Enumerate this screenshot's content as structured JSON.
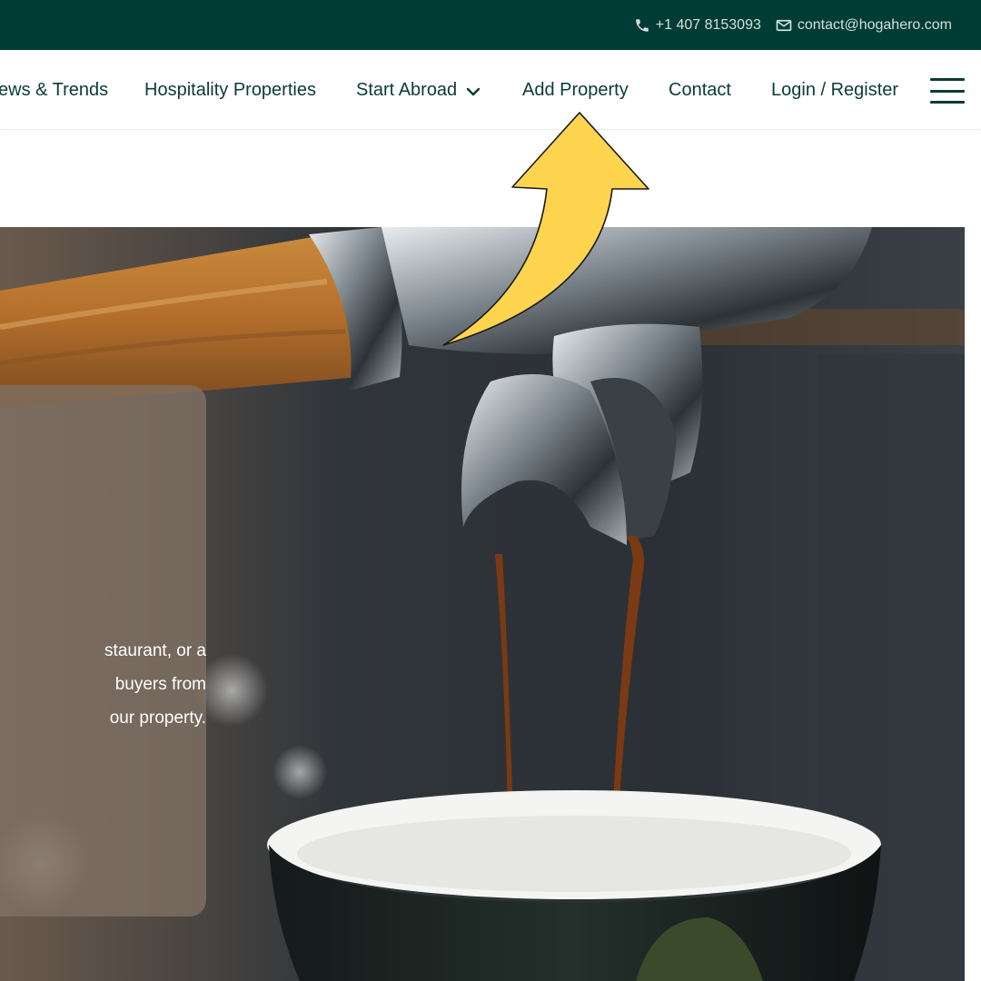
{
  "topbar": {
    "phone": "+1 407 8153093",
    "email": "contact@hogahero.com",
    "phone_icon": "phone-icon",
    "email_icon": "envelope-icon"
  },
  "nav": {
    "items": [
      {
        "label": "ews & Trends"
      },
      {
        "label": "Hospitality Properties"
      },
      {
        "label": "Start Abroad"
      },
      {
        "label": "Add Property"
      },
      {
        "label": "Contact"
      },
      {
        "label": "Login / Register"
      }
    ],
    "dropdown_icon": "chevron-down-icon",
    "menu_icon": "hamburger-menu-icon"
  },
  "hero": {
    "card_lines": [
      "staurant, or a",
      "buyers from",
      "our property."
    ]
  },
  "annotation": {
    "icon": "curved-arrow-icon",
    "color": "#ffd54f"
  },
  "colors": {
    "topbar_bg": "#003c35",
    "nav_text": "#0b3b36",
    "card_bg": "#807064"
  }
}
